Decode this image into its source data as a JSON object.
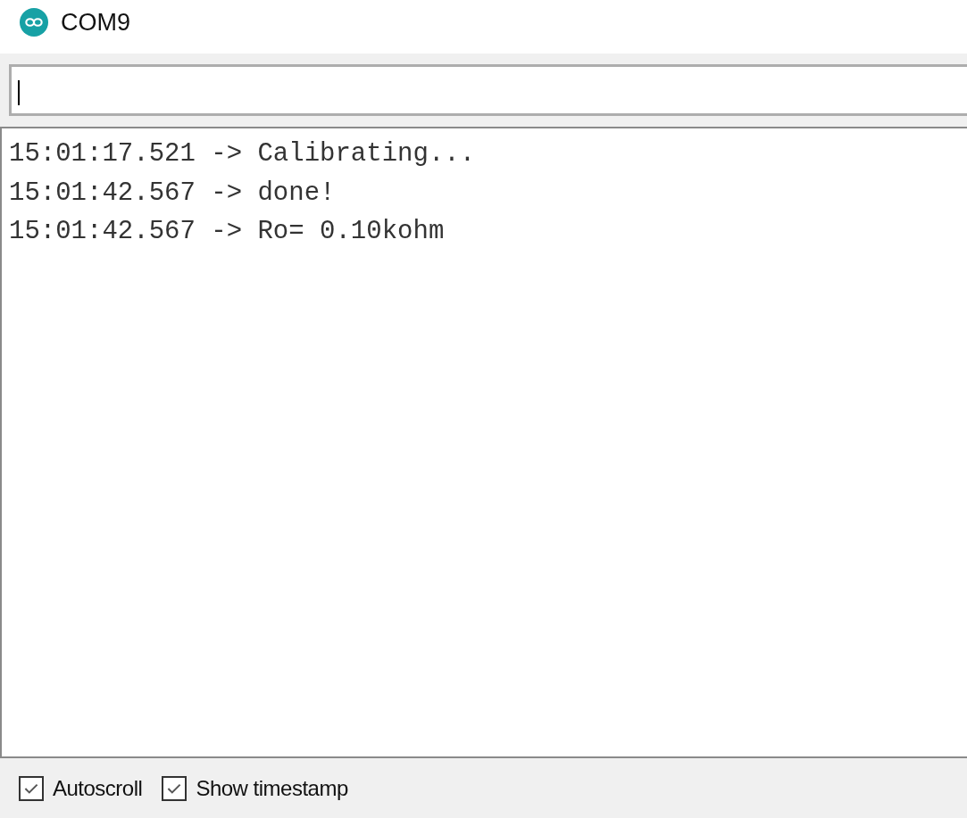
{
  "window": {
    "title": "COM9"
  },
  "output": [
    {
      "time": "15:01:17.521",
      "arrow": "->",
      "message": "Calibrating..."
    },
    {
      "time": "15:01:42.567",
      "arrow": "->",
      "message": "done!"
    },
    {
      "time": "15:01:42.567",
      "arrow": "->",
      "message": "Ro= 0.10kohm"
    }
  ],
  "options": [
    {
      "label": "Autoscroll",
      "checked": true
    },
    {
      "label": "Show timestamp",
      "checked": true
    }
  ]
}
